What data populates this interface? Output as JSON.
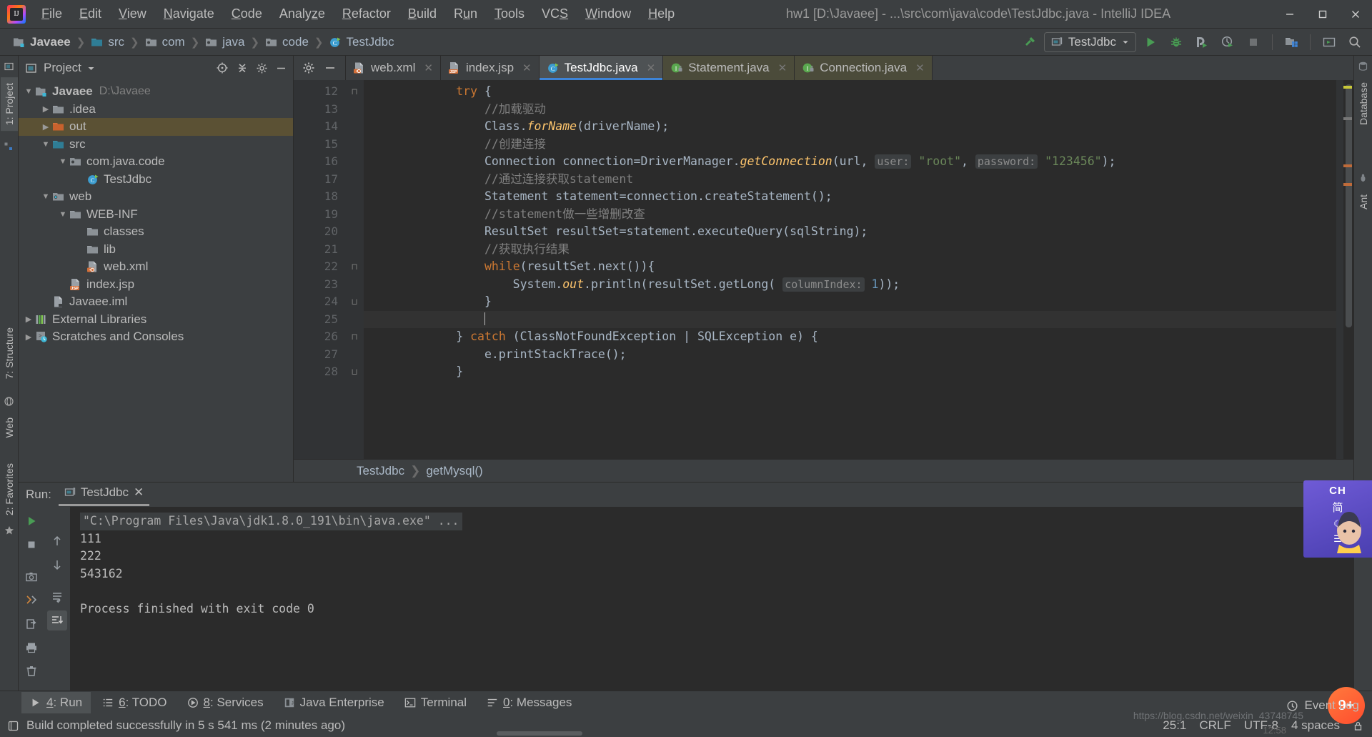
{
  "window": {
    "title": "hw1 [D:\\Javaee] - ...\\src\\com\\java\\code\\TestJdbc.java - IntelliJ IDEA",
    "minimize": "—",
    "maximize": "❑",
    "close": "✕"
  },
  "menubar": [
    {
      "label": "File",
      "mnemonic": "F"
    },
    {
      "label": "Edit",
      "mnemonic": "E"
    },
    {
      "label": "View",
      "mnemonic": "V"
    },
    {
      "label": "Navigate",
      "mnemonic": "N"
    },
    {
      "label": "Code",
      "mnemonic": "C"
    },
    {
      "label": "Analyze",
      "mnemonic": "z"
    },
    {
      "label": "Refactor",
      "mnemonic": "R"
    },
    {
      "label": "Build",
      "mnemonic": "B"
    },
    {
      "label": "Run",
      "mnemonic": "u"
    },
    {
      "label": "Tools",
      "mnemonic": "T"
    },
    {
      "label": "VCS",
      "mnemonic": "S"
    },
    {
      "label": "Window",
      "mnemonic": "W"
    },
    {
      "label": "Help",
      "mnemonic": "H"
    }
  ],
  "navbar": {
    "crumbs": [
      {
        "label": "Javaee",
        "icon": "module-icon"
      },
      {
        "label": "src",
        "icon": "source-folder-icon"
      },
      {
        "label": "com",
        "icon": "package-icon"
      },
      {
        "label": "java",
        "icon": "package-icon"
      },
      {
        "label": "code",
        "icon": "package-icon"
      },
      {
        "label": "TestJdbc",
        "icon": "java-class-icon"
      }
    ],
    "separator": "❯",
    "run_config": "TestJdbc",
    "buttons": [
      {
        "name": "build-hammer-icon"
      },
      {
        "name": "run-button"
      },
      {
        "name": "debug-button"
      },
      {
        "name": "run-coverage-button"
      },
      {
        "name": "profiler-button"
      },
      {
        "name": "stop-button"
      },
      {
        "name": "project-structure-button"
      },
      {
        "name": "update-button"
      },
      {
        "name": "search-everywhere-button"
      }
    ]
  },
  "left_strips": {
    "top": [
      "1: Project"
    ],
    "middle": [
      "7: Structure"
    ],
    "bottom": [
      "2: Favorites"
    ],
    "web": "Web"
  },
  "right_strips": [
    "Database",
    "Ant"
  ],
  "project_panel": {
    "title": "Project",
    "tree": [
      {
        "depth": 0,
        "arrow": "▼",
        "icon": "module-icon",
        "label": "Javaee",
        "bold": true,
        "path": "D:\\Javaee",
        "selected": false
      },
      {
        "depth": 1,
        "arrow": "▶",
        "icon": "folder-icon",
        "label": ".idea",
        "bold": false,
        "path": "",
        "selected": false
      },
      {
        "depth": 1,
        "arrow": "▶",
        "icon": "output-folder-icon",
        "label": "out",
        "bold": false,
        "path": "",
        "selected": true
      },
      {
        "depth": 1,
        "arrow": "▼",
        "icon": "source-folder-icon",
        "label": "src",
        "bold": false,
        "path": "",
        "selected": false
      },
      {
        "depth": 2,
        "arrow": "▼",
        "icon": "package-icon",
        "label": "com.java.code",
        "bold": false,
        "path": "",
        "selected": false
      },
      {
        "depth": 3,
        "arrow": "",
        "icon": "java-class-icon",
        "label": "TestJdbc",
        "bold": false,
        "path": "",
        "selected": false
      },
      {
        "depth": 1,
        "arrow": "▼",
        "icon": "web-folder-icon",
        "label": "web",
        "bold": false,
        "path": "",
        "selected": false
      },
      {
        "depth": 2,
        "arrow": "▼",
        "icon": "folder-icon",
        "label": "WEB-INF",
        "bold": false,
        "path": "",
        "selected": false
      },
      {
        "depth": 3,
        "arrow": "",
        "icon": "folder-icon",
        "label": "classes",
        "bold": false,
        "path": "",
        "selected": false
      },
      {
        "depth": 3,
        "arrow": "",
        "icon": "folder-icon",
        "label": "lib",
        "bold": false,
        "path": "",
        "selected": false
      },
      {
        "depth": 3,
        "arrow": "",
        "icon": "xml-file-icon",
        "label": "web.xml",
        "bold": false,
        "path": "",
        "selected": false
      },
      {
        "depth": 2,
        "arrow": "",
        "icon": "jsp-file-icon",
        "label": "index.jsp",
        "bold": false,
        "path": "",
        "selected": false
      },
      {
        "depth": 1,
        "arrow": "",
        "icon": "iml-file-icon",
        "label": "Javaee.iml",
        "bold": false,
        "path": "",
        "selected": false
      },
      {
        "depth": 0,
        "arrow": "▶",
        "icon": "external-libraries-icon",
        "label": "External Libraries",
        "bold": false,
        "path": "",
        "selected": false
      },
      {
        "depth": 0,
        "arrow": "▶",
        "icon": "scratches-icon",
        "label": "Scratches and Consoles",
        "bold": false,
        "path": "",
        "selected": false
      }
    ]
  },
  "editor": {
    "tabs": [
      {
        "label": "web.xml",
        "icon": "xml-file-icon",
        "active": false,
        "close": "✕"
      },
      {
        "label": "index.jsp",
        "icon": "jsp-file-icon",
        "active": false,
        "close": "✕"
      },
      {
        "label": "TestJdbc.java",
        "icon": "java-class-icon",
        "active": true,
        "close": "✕"
      },
      {
        "label": "Statement.java",
        "icon": "java-interface-icon",
        "active": false,
        "close": "✕"
      },
      {
        "label": "Connection.java",
        "icon": "java-interface-icon",
        "active": false,
        "close": "✕"
      }
    ],
    "first_line_number": 12,
    "lines": [
      {
        "n": 12,
        "fold": "⊓",
        "tokens": [
          {
            "t": "            ",
            "c": ""
          },
          {
            "t": "try",
            "c": "kw"
          },
          {
            "t": " {",
            "c": ""
          }
        ]
      },
      {
        "n": 13,
        "fold": "",
        "tokens": [
          {
            "t": "                ",
            "c": ""
          },
          {
            "t": "//加载驱动",
            "c": "cmt"
          }
        ]
      },
      {
        "n": 14,
        "fold": "",
        "tokens": [
          {
            "t": "                Class.",
            "c": ""
          },
          {
            "t": "forName",
            "c": "meth"
          },
          {
            "t": "(driverName);",
            "c": ""
          }
        ]
      },
      {
        "n": 15,
        "fold": "",
        "tokens": [
          {
            "t": "                ",
            "c": ""
          },
          {
            "t": "//创建连接",
            "c": "cmt"
          }
        ]
      },
      {
        "n": 16,
        "fold": "",
        "tokens": [
          {
            "t": "                Connection connection=DriverManager.",
            "c": ""
          },
          {
            "t": "getConnection",
            "c": "meth"
          },
          {
            "t": "(url, ",
            "c": ""
          },
          {
            "t": "user:",
            "c": "hint"
          },
          {
            "t": " ",
            "c": ""
          },
          {
            "t": "\"root\"",
            "c": "str"
          },
          {
            "t": ", ",
            "c": ""
          },
          {
            "t": "password:",
            "c": "hint"
          },
          {
            "t": " ",
            "c": ""
          },
          {
            "t": "\"123456\"",
            "c": "str"
          },
          {
            "t": ");",
            "c": ""
          }
        ]
      },
      {
        "n": 17,
        "fold": "",
        "tokens": [
          {
            "t": "                ",
            "c": ""
          },
          {
            "t": "//通过连接获取statement",
            "c": "cmt"
          }
        ]
      },
      {
        "n": 18,
        "fold": "",
        "tokens": [
          {
            "t": "                Statement statement=connection.createStatement();",
            "c": ""
          }
        ]
      },
      {
        "n": 19,
        "fold": "",
        "tokens": [
          {
            "t": "                ",
            "c": ""
          },
          {
            "t": "//statement做一些增删改查",
            "c": "cmt"
          }
        ]
      },
      {
        "n": 20,
        "fold": "",
        "tokens": [
          {
            "t": "                ResultSet resultSet=statement.executeQuery(sqlString);",
            "c": ""
          }
        ]
      },
      {
        "n": 21,
        "fold": "",
        "tokens": [
          {
            "t": "                ",
            "c": ""
          },
          {
            "t": "//获取执行结果",
            "c": "cmt"
          }
        ]
      },
      {
        "n": 22,
        "fold": "⊓",
        "tokens": [
          {
            "t": "                ",
            "c": ""
          },
          {
            "t": "while",
            "c": "kw"
          },
          {
            "t": "(resultSet.next()){",
            "c": ""
          }
        ]
      },
      {
        "n": 23,
        "fold": "",
        "tokens": [
          {
            "t": "                    System.",
            "c": ""
          },
          {
            "t": "out",
            "c": "meth"
          },
          {
            "t": ".println(resultSet.getLong( ",
            "c": ""
          },
          {
            "t": "columnIndex:",
            "c": "hint"
          },
          {
            "t": " ",
            "c": ""
          },
          {
            "t": "1",
            "c": "num"
          },
          {
            "t": "));",
            "c": ""
          }
        ]
      },
      {
        "n": 24,
        "fold": "⊔",
        "tokens": [
          {
            "t": "                }",
            "c": ""
          }
        ]
      },
      {
        "n": 25,
        "fold": "",
        "tokens": [
          {
            "t": "                ",
            "c": ""
          }
        ],
        "current": true
      },
      {
        "n": 26,
        "fold": "⊓",
        "tokens": [
          {
            "t": "            } ",
            "c": ""
          },
          {
            "t": "catch",
            "c": "kw"
          },
          {
            "t": " (ClassNotFoundException | SQLException e) {",
            "c": ""
          }
        ]
      },
      {
        "n": 27,
        "fold": "",
        "tokens": [
          {
            "t": "                e.printStackTrace();",
            "c": ""
          }
        ]
      },
      {
        "n": 28,
        "fold": "⊔",
        "tokens": [
          {
            "t": "            }",
            "c": ""
          }
        ]
      }
    ],
    "breadcrumb": [
      "TestJdbc",
      "getMysql()"
    ],
    "breadcrumb_sep": "❯"
  },
  "run_panel": {
    "label": "Run:",
    "tab": "TestJdbc",
    "tab_close": "✕",
    "console": [
      {
        "text": "\"C:\\Program Files\\Java\\jdk1.8.0_191\\bin\\java.exe\" ...",
        "cmd": true
      },
      {
        "text": "111",
        "cmd": false
      },
      {
        "text": "222",
        "cmd": false
      },
      {
        "text": "543162",
        "cmd": false
      },
      {
        "text": "",
        "cmd": false
      },
      {
        "text": "Process finished with exit code 0",
        "cmd": false
      }
    ],
    "left_buttons": [
      "rerun-button",
      "stop-button",
      "screenshot-button",
      "thread-dump-button",
      "export-button",
      "print-button",
      "clear-all-button"
    ],
    "mid_buttons": [
      "scroll-up-icon",
      "scroll-down-icon",
      "soft-wrap-button",
      "scroll-to-end-button"
    ],
    "settings_icon": "gear-icon",
    "hide_icon": "minimize-icon"
  },
  "tool_windows": [
    {
      "num": "4",
      "label": "Run",
      "icon": "run-icon",
      "active": true
    },
    {
      "num": "6",
      "label": "TODO",
      "icon": "todo-icon",
      "active": false
    },
    {
      "num": "8",
      "label": "Services",
      "icon": "services-icon",
      "active": false
    },
    {
      "num": "",
      "label": "Java Enterprise",
      "icon": "java-enterprise-icon",
      "active": false
    },
    {
      "num": "",
      "label": "Terminal",
      "icon": "terminal-icon",
      "active": false
    },
    {
      "num": "0",
      "label": "Messages",
      "icon": "messages-icon",
      "active": false
    }
  ],
  "event_log": "Event Log",
  "statusbar": {
    "message": "Build completed successfully in 5 s 541 ms (2 minutes ago)",
    "caret": "25:1",
    "line_sep": "CRLF",
    "encoding": "UTF-8",
    "indent": "4 spaces",
    "lock_icon": "lock-icon"
  },
  "floating": {
    "ad_label": "CH",
    "ad_label2": "简",
    "badge": "9+",
    "watermark": "https://blog.csdn.net/weixin_43748745",
    "clock": "12:58"
  },
  "colors": {
    "bg": "#3c3f41",
    "editor_bg": "#2b2b2b",
    "accent": "#3d84d8",
    "selection": "#5b5134",
    "green": "#499c54",
    "keyword": "#cc7832",
    "string": "#6a8759",
    "comment": "#808080",
    "method": "#ffc66d",
    "number": "#6897bb",
    "text": "#a9b7c6"
  }
}
